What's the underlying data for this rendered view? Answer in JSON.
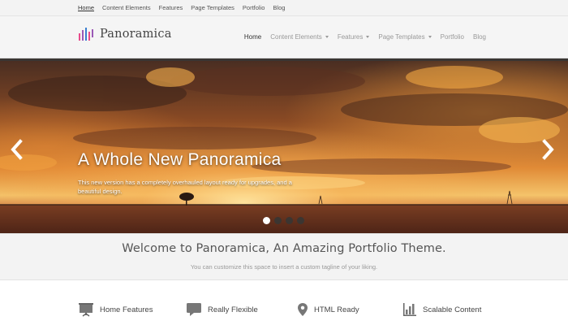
{
  "topnav": {
    "items": [
      {
        "label": "Home",
        "active": true
      },
      {
        "label": "Content Elements",
        "active": false
      },
      {
        "label": "Features",
        "active": false
      },
      {
        "label": "Page Templates",
        "active": false
      },
      {
        "label": "Portfolio",
        "active": false
      },
      {
        "label": "Blog",
        "active": false
      }
    ]
  },
  "header": {
    "logo_text": "Panoramica",
    "logo_icon": "bars-logo-icon",
    "logo_colors": [
      "#e84c8b",
      "#9b59b6",
      "#3b7fd0",
      "#e84c8b",
      "#9b59b6"
    ],
    "nav": [
      {
        "label": "Home",
        "active": true,
        "dropdown": false
      },
      {
        "label": "Content Elements",
        "active": false,
        "dropdown": true
      },
      {
        "label": "Features",
        "active": false,
        "dropdown": true
      },
      {
        "label": "Page Templates",
        "active": false,
        "dropdown": true
      },
      {
        "label": "Portfolio",
        "active": false,
        "dropdown": false
      },
      {
        "label": "Blog",
        "active": false,
        "dropdown": false
      }
    ]
  },
  "hero": {
    "title": "A Whole New Panoramica",
    "description": "This new version has a completely overhauled layout ready for upgrades, and a beautiful design.",
    "prev_icon": "chevron-left-icon",
    "next_icon": "chevron-right-icon",
    "slides_count": 4,
    "active_slide": 1
  },
  "welcome": {
    "title": "Welcome to Panoramica, An Amazing Portfolio Theme.",
    "tagline": "You can customize this space to insert a custom tagline of your liking."
  },
  "features": [
    {
      "label": "Home Features",
      "icon": "presentation-board-icon"
    },
    {
      "label": "Really Flexible",
      "icon": "speech-bubble-icon"
    },
    {
      "label": "HTML Ready",
      "icon": "map-pin-icon"
    },
    {
      "label": "Scalable Content",
      "icon": "bar-chart-icon"
    }
  ],
  "colors": {
    "accent": "#3b3531",
    "header_bg": "#f5f5f5",
    "topbar_bg": "#f3f3f3",
    "text_dark": "#444444",
    "text_muted": "#999999"
  }
}
